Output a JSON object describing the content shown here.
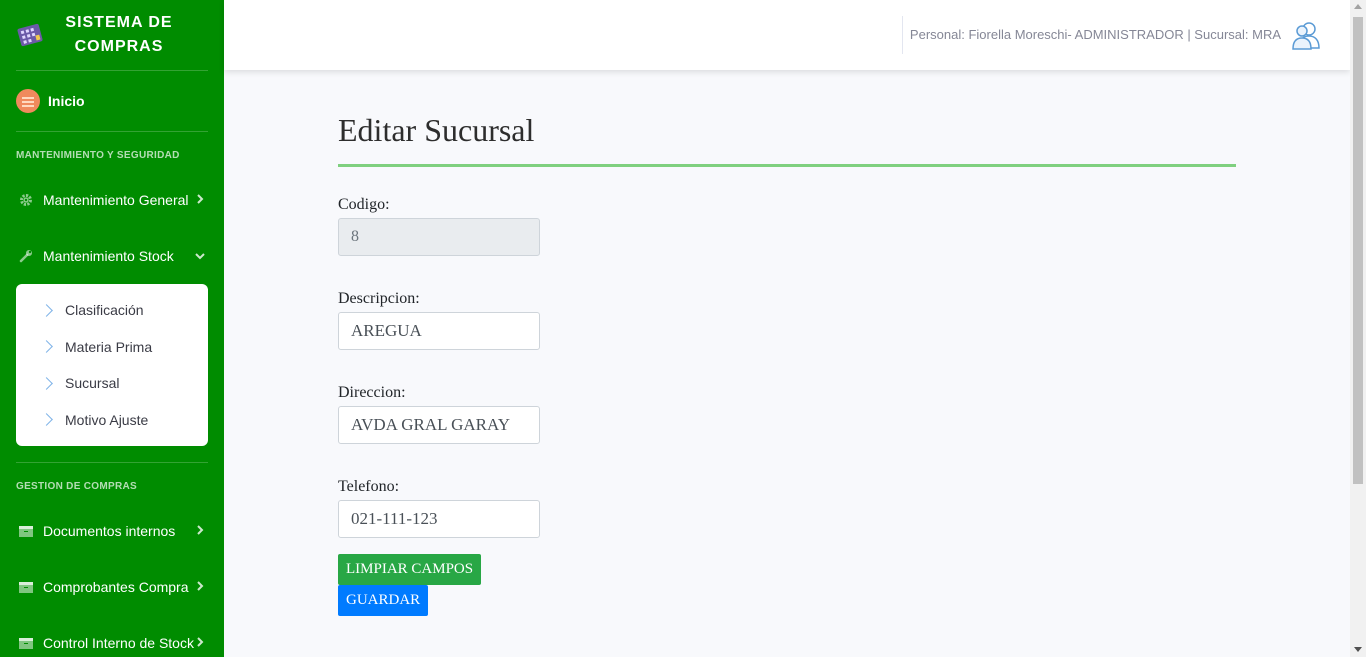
{
  "sidebar": {
    "brand_line1": "SISTEMA DE",
    "brand_line2": "COMPRAS",
    "home_label": "Inicio",
    "section1_heading": "MANTENIMIENTO Y SEGURIDAD",
    "item_mant_general": "Mantenimiento General",
    "item_mant_stock": "Mantenimiento Stock",
    "stock_submenu": [
      "Clasificación",
      "Materia Prima",
      "Sucursal",
      "Motivo Ajuste"
    ],
    "section2_heading": "GESTION DE COMPRAS",
    "item_docs_internos": "Documentos internos",
    "item_comprobantes": "Comprobantes Compra",
    "item_control_stock": "Control Interno de Stock"
  },
  "topbar": {
    "user_info": "Personal: Fiorella Moreschi- ADMINISTRADOR | Sucursal: MRA"
  },
  "form": {
    "title": "Editar Sucursal",
    "codigo_label": "Codigo:",
    "codigo_value": "8",
    "descripcion_label": "Descripcion:",
    "descripcion_value": "AREGUA",
    "direccion_label": "Direccion:",
    "direccion_value": "AVDA GRAL GARAY",
    "telefono_label": "Telefono:",
    "telefono_value": "021-111-123",
    "clear_button": "LIMPIAR CAMPOS",
    "save_button": "GUARDAR"
  },
  "colors": {
    "sidebar_bg": "#008c00",
    "accent_line": "#7fd07f",
    "btn_clear": "#28a745",
    "btn_save": "#007bff"
  }
}
